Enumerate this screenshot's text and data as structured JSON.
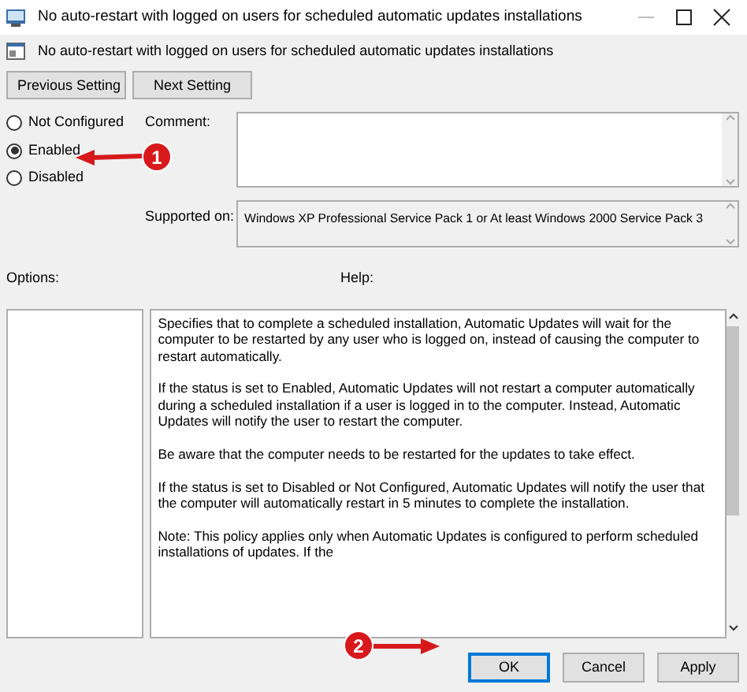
{
  "window": {
    "title": "No auto-restart with logged on users for scheduled automatic updates installations"
  },
  "header": {
    "title": "No auto-restart with logged on users for scheduled automatic updates installations"
  },
  "nav_buttons": [
    "Previous Setting",
    "Next Setting"
  ],
  "radios": [
    {
      "label": "Not Configured",
      "selected": false
    },
    {
      "label": "Enabled",
      "selected": true
    },
    {
      "label": "Disabled",
      "selected": false
    }
  ],
  "comment": {
    "label": "Comment:"
  },
  "supported_on": {
    "label": "Supported on:",
    "value": "Windows XP Professional Service Pack 1 or At least Windows 2000 Service Pack 3"
  },
  "options": {
    "label": "Options:"
  },
  "help": {
    "label": "Help:",
    "paragraphs": [
      "Specifies that to complete a scheduled installation, Automatic Updates will wait for the computer to be restarted by any user who is logged on, instead of causing the computer to restart automatically.",
      "If the status is set to Enabled, Automatic Updates will not restart a computer automatically during a scheduled installation if a user is logged in to the computer. Instead, Automatic Updates will notify the user to restart the computer.",
      "Be aware that the computer needs to be restarted for the updates to take effect.",
      "If the status is set to Disabled or Not Configured, Automatic Updates will notify the user that the computer will automatically restart in 5 minutes to complete the installation.",
      "Note: This policy applies only when Automatic Updates is configured to perform scheduled installations of updates. If the"
    ]
  },
  "buttons": [
    {
      "label": "OK",
      "selected": true
    },
    {
      "label": "Cancel",
      "selected": false
    },
    {
      "label": "Apply",
      "selected": false
    }
  ],
  "annotations": [
    {
      "number": "1"
    },
    {
      "number": "2"
    }
  ]
}
